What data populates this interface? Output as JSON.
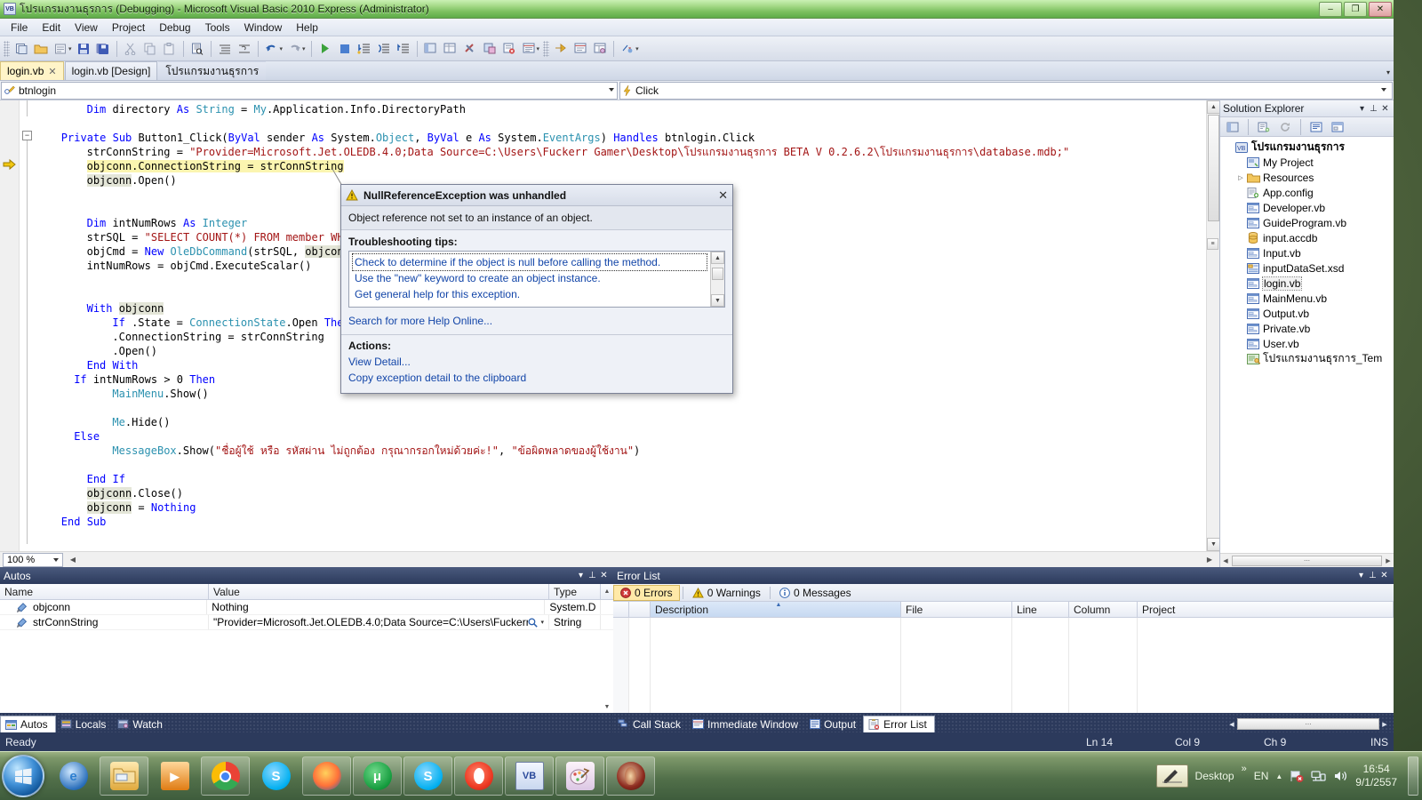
{
  "window": {
    "title": "โปรแกรมงานธุรการ (Debugging) - Microsoft Visual Basic 2010 Express (Administrator)",
    "minimize": "–",
    "maximize": "❐",
    "close": "✕"
  },
  "menu": {
    "items": [
      "File",
      "Edit",
      "View",
      "Project",
      "Debug",
      "Tools",
      "Window",
      "Help"
    ]
  },
  "toolbar": {
    "groups": [
      [
        "new-item-icon",
        "open-file-icon",
        "add-new-item-icon",
        "save-icon",
        "save-all-icon"
      ],
      [
        "cut-icon",
        "copy-icon",
        "paste-icon"
      ],
      [
        "find-icon"
      ],
      [
        "comment-icon",
        "uncomment-icon"
      ],
      [
        "undo-icon",
        "redo-icon"
      ],
      [
        "start-debug-icon",
        "stop-debug-icon",
        "step-into-icon",
        "step-over-icon",
        "step-out-icon"
      ],
      [
        "solution-explorer-icon",
        "properties-window-icon",
        "toolbox-icon",
        "object-browser-icon",
        "error-list-icon",
        "output-window-icon"
      ],
      [
        "next-bookmark-icon",
        "immediate-window-icon",
        "watch-window-icon"
      ],
      [
        "breakpoint-icon"
      ]
    ]
  },
  "editor_tabs": [
    {
      "label": "login.vb",
      "closable": true,
      "active": true
    },
    {
      "label": "login.vb [Design]",
      "closable": false,
      "active": false
    },
    {
      "label": "โปรแกรมงานธุรการ",
      "closable": false,
      "active": false
    }
  ],
  "nav": {
    "left_value": "btnlogin",
    "right_value": "Click",
    "left_icon": "member-icon",
    "right_icon": "event-lightning-icon"
  },
  "code": {
    "zoom": "100 %",
    "lines": [
      {
        "indent": 8,
        "html": "<span class=\"kw\">Dim</span> directory <span class=\"kw\">As</span> <span class=\"ty\">String</span> = <span class=\"ty\">My</span>.Application.Info.DirectoryPath"
      },
      {
        "indent": 0,
        "html": ""
      },
      {
        "indent": 4,
        "html": "<span class=\"kw\">Private Sub</span> Button1_Click(<span class=\"kw\">ByVal</span> sender <span class=\"kw\">As</span> System.<span class=\"ty\">Object</span>, <span class=\"kw\">ByVal</span> e <span class=\"kw\">As</span> System.<span class=\"ty\">EventArgs</span>) <span class=\"kw\">Handles</span> btnlogin.Click"
      },
      {
        "indent": 8,
        "html": "strConnString = <span class=\"st\">\"Provider=Microsoft.Jet.OLEDB.4.0;Data Source=C:\\Users\\Fuckerr Gamer\\Desktop\\โปรแกรมงานธุรการ BETA V 0.2.6.2\\โปรแกรมงานธุรการ\\database.mdb;\"</span>"
      },
      {
        "indent": 8,
        "html": "<span class=\"hl\">objconn.ConnectionString = strConnString</span>"
      },
      {
        "indent": 8,
        "html": "<span class=\"gray-hl\">objconn</span>.Open()"
      },
      {
        "indent": 0,
        "html": ""
      },
      {
        "indent": 0,
        "html": ""
      },
      {
        "indent": 8,
        "html": "<span class=\"kw\">Dim</span> intNumRows <span class=\"kw\">As</span> <span class=\"ty\">Integer</span>"
      },
      {
        "indent": 8,
        "html": "strSQL = <span class=\"st\">\"SELECT COUNT(*) FROM member WHERE</span>                             txtPass.Text &amp; <span class=\"st\">\"' \"</span>"
      },
      {
        "indent": 8,
        "html": "objCmd = <span class=\"kw\">New</span> <span class=\"ty\">OleDbCommand</span>(strSQL, <span class=\"gray-hl\">objconn</span>)"
      },
      {
        "indent": 8,
        "html": "intNumRows = objCmd.ExecuteScalar()"
      },
      {
        "indent": 0,
        "html": ""
      },
      {
        "indent": 0,
        "html": ""
      },
      {
        "indent": 8,
        "html": "<span class=\"kw\">With</span> <span class=\"gray-hl\">objconn</span>"
      },
      {
        "indent": 12,
        "html": "<span class=\"kw\">If</span> .State = <span class=\"ty\">ConnectionState</span>.Open <span class=\"kw\">Then</span>"
      },
      {
        "indent": 12,
        "html": ".ConnectionString = strConnString"
      },
      {
        "indent": 12,
        "html": ".Open()"
      },
      {
        "indent": 8,
        "html": "<span class=\"kw\">End With</span>"
      },
      {
        "indent": 6,
        "html": "<span class=\"kw\">If</span> intNumRows &gt; 0 <span class=\"kw\">Then</span>"
      },
      {
        "indent": 12,
        "html": "<span class=\"ty\">MainMenu</span>.Show()"
      },
      {
        "indent": 0,
        "html": ""
      },
      {
        "indent": 12,
        "html": "<span class=\"ty\">Me</span>.Hide()"
      },
      {
        "indent": 6,
        "html": "<span class=\"kw\">Else</span>"
      },
      {
        "indent": 12,
        "html": "<span class=\"ty\">MessageBox</span>.Show(<span class=\"st\">\"ชื่อผู้ใช้ หรือ รหัสผ่าน ไม่ถูกต้อง กรุณากรอกใหม่ด้วยค่ะ!\"</span>, <span class=\"st\">\"ข้อผิดพลาดของผู้ใช้งาน\"</span>)"
      },
      {
        "indent": 0,
        "html": ""
      },
      {
        "indent": 8,
        "html": "<span class=\"kw\">End If</span>"
      },
      {
        "indent": 8,
        "html": "<span class=\"gray-hl\">objconn</span>.Close()"
      },
      {
        "indent": 8,
        "html": "<span class=\"gray-hl\">objconn</span> = <span class=\"kw\">Nothing</span>"
      },
      {
        "indent": 4,
        "html": "<span class=\"kw\">End Sub</span>"
      }
    ]
  },
  "solution_explorer": {
    "title": "Solution Explorer",
    "toolbar_icons": [
      "properties-icon",
      "show-all-files-icon",
      "refresh-icon",
      "view-code-icon",
      "view-designer-icon"
    ],
    "header_buttons": [
      "window-position-icon",
      "auto-hide-pin-icon",
      "close-icon"
    ],
    "tree": [
      {
        "label": "โปรแกรมงานธุรการ",
        "icon": "vb-project-icon",
        "depth": 0,
        "expander": "",
        "root": true,
        "selected": false
      },
      {
        "label": "My Project",
        "icon": "my-project-icon",
        "depth": 1,
        "expander": "",
        "root": false,
        "selected": false
      },
      {
        "label": "Resources",
        "icon": "folder-icon",
        "depth": 1,
        "expander": "▷",
        "root": false,
        "selected": false
      },
      {
        "label": "App.config",
        "icon": "config-file-icon",
        "depth": 1,
        "expander": "",
        "root": false,
        "selected": false
      },
      {
        "label": "Developer.vb",
        "icon": "vb-form-icon",
        "depth": 1,
        "expander": "",
        "root": false,
        "selected": false
      },
      {
        "label": "GuideProgram.vb",
        "icon": "vb-form-icon",
        "depth": 1,
        "expander": "",
        "root": false,
        "selected": false
      },
      {
        "label": "input.accdb",
        "icon": "database-icon",
        "depth": 1,
        "expander": "",
        "root": false,
        "selected": false
      },
      {
        "label": "Input.vb",
        "icon": "vb-form-icon",
        "depth": 1,
        "expander": "",
        "root": false,
        "selected": false
      },
      {
        "label": "inputDataSet.xsd",
        "icon": "dataset-icon",
        "depth": 1,
        "expander": "",
        "root": false,
        "selected": false
      },
      {
        "label": "login.vb",
        "icon": "vb-form-icon",
        "depth": 1,
        "expander": "",
        "root": false,
        "selected": true
      },
      {
        "label": "MainMenu.vb",
        "icon": "vb-form-icon",
        "depth": 1,
        "expander": "",
        "root": false,
        "selected": false
      },
      {
        "label": "Output.vb",
        "icon": "vb-form-icon",
        "depth": 1,
        "expander": "",
        "root": false,
        "selected": false
      },
      {
        "label": "Private.vb",
        "icon": "vb-form-icon",
        "depth": 1,
        "expander": "",
        "root": false,
        "selected": false
      },
      {
        "label": "User.vb",
        "icon": "vb-form-icon",
        "depth": 1,
        "expander": "",
        "root": false,
        "selected": false
      },
      {
        "label": "โปรแกรมงานธุรการ_Tem",
        "icon": "settings-key-icon",
        "depth": 1,
        "expander": "",
        "root": false,
        "selected": false
      }
    ]
  },
  "autos": {
    "title": "Autos",
    "columns": [
      "Name",
      "Value",
      "Type"
    ],
    "rows": [
      {
        "name": "objconn",
        "value": "Nothing",
        "type": "System.D",
        "magnifier": false
      },
      {
        "name": "strConnString",
        "value": "\"Provider=Microsoft.Jet.OLEDB.4.0;Data Source=C:\\Users\\Fuckerr Ga",
        "type": "String",
        "magnifier": true
      }
    ],
    "tabs": [
      {
        "label": "Autos",
        "icon": "autos-icon",
        "active": true
      },
      {
        "label": "Locals",
        "icon": "locals-icon",
        "active": false
      },
      {
        "label": "Watch",
        "icon": "watch-icon",
        "active": false
      }
    ]
  },
  "error_list": {
    "title": "Error List",
    "filters": [
      {
        "label": "0 Errors",
        "icon": "error-icon",
        "active": true
      },
      {
        "label": "0 Warnings",
        "icon": "warning-icon",
        "active": false
      },
      {
        "label": "0 Messages",
        "icon": "info-icon",
        "active": false
      }
    ],
    "columns": [
      "",
      "",
      "Description",
      "File",
      "Line",
      "Column",
      "Project"
    ],
    "rows": [],
    "tabs": [
      {
        "label": "Call Stack",
        "icon": "call-stack-icon",
        "active": false
      },
      {
        "label": "Immediate Window",
        "icon": "immediate-window-icon",
        "active": false
      },
      {
        "label": "Output",
        "icon": "output-icon",
        "active": false
      },
      {
        "label": "Error List",
        "icon": "error-list-icon",
        "active": true
      }
    ]
  },
  "status_bar": {
    "ready": "Ready",
    "line": "Ln 14",
    "column": "Col 9",
    "character": "Ch 9",
    "insert_mode": "INS"
  },
  "exception_dialog": {
    "title": "NullReferenceException was unhandled",
    "message": "Object reference not set to an instance of an object.",
    "tips_label": "Troubleshooting tips:",
    "tips": [
      "Check to determine if the object is null before calling the method.",
      "Use the \"new\" keyword to create an object instance.",
      "Get general help for this exception."
    ],
    "search_more": "Search for more Help Online...",
    "actions_label": "Actions:",
    "actions": [
      "View Detail...",
      "Copy exception detail to the clipboard"
    ],
    "close": "✕"
  },
  "taskbar": {
    "start_icon": "windows-start-orb-icon",
    "items": [
      {
        "name": "internet-explorer-icon",
        "glyph": "e",
        "color": "#2d7fd0",
        "bg": "radial-gradient(circle at 40% 35%, #cfe8ff, #2a6fbb 70%, #13497f)",
        "pinned": true,
        "flat": true
      },
      {
        "name": "file-explorer-icon",
        "glyph": "",
        "color": "#d9a13b",
        "bg": "linear-gradient(#ffe9b0,#e0a93c)",
        "pinned": true,
        "flat": false
      },
      {
        "name": "windows-media-player-icon",
        "glyph": "▶",
        "color": "#e98a1f",
        "bg": "linear-gradient(#ffd79a,#e07c14)",
        "pinned": true,
        "flat": true
      },
      {
        "name": "google-chrome-icon",
        "glyph": "",
        "color": "#4285f4",
        "bg": "conic-gradient(#ea4335 0 33%, #34a853 33% 66%, #fbbc05 66% 100%)",
        "pinned": true,
        "flat": false
      },
      {
        "name": "skype-icon",
        "glyph": "S",
        "color": "#ffffff",
        "bg": "radial-gradient(circle at 40% 35%, #89d8ff, #00aff0 70%, #0078a8)",
        "pinned": true,
        "flat": true
      },
      {
        "name": "mozilla-firefox-icon",
        "glyph": "",
        "color": "#ff7139",
        "bg": "radial-gradient(circle at 45% 40%, #ffd15c, #ff7139 55%, #1a5fb4 100%)",
        "pinned": true,
        "flat": false
      },
      {
        "name": "utorrent-icon",
        "glyph": "μ",
        "color": "#ffffff",
        "bg": "radial-gradient(circle at 40% 35%, #6fd98a, #149b3d 70%, #0b6b28)",
        "pinned": true,
        "flat": false
      },
      {
        "name": "skype-window-icon",
        "glyph": "S",
        "color": "#ffffff",
        "bg": "radial-gradient(circle at 40% 35%, #89d8ff, #00aff0 70%, #0078a8)",
        "pinned": true,
        "flat": false
      },
      {
        "name": "opera-icon",
        "glyph": "",
        "color": "#ff1b2d",
        "bg": "radial-gradient(circle at 45% 40%, #ff8a70, #ee3b24 60%, #b81b10)",
        "pinned": true,
        "flat": false
      },
      {
        "name": "visual-basic-icon",
        "glyph": "VB",
        "color": "#2b4a9b",
        "bg": "linear-gradient(#f3f7ff,#c9d7ef)",
        "pinned": true,
        "flat": false
      },
      {
        "name": "paint-icon",
        "glyph": "",
        "color": "#c05a8f",
        "bg": "linear-gradient(#fdf3fa,#dcc7e4)",
        "pinned": true,
        "flat": false
      },
      {
        "name": "program-window-icon",
        "glyph": "",
        "color": "#7a1c1c",
        "bg": "radial-gradient(circle at 45% 40%, #e8c7a0, #8d2b1f 60%, #43120c)",
        "pinned": true,
        "flat": false
      }
    ],
    "tray": {
      "pen_icon": "tablet-pen-input-icon",
      "desktop_label": "Desktop",
      "overflow": "»",
      "language": "EN",
      "show_hidden": "▲",
      "icons": [
        "action-center-flag-icon",
        "network-icon",
        "volume-icon"
      ],
      "time": "16:54",
      "date": "9/1/2557"
    }
  }
}
